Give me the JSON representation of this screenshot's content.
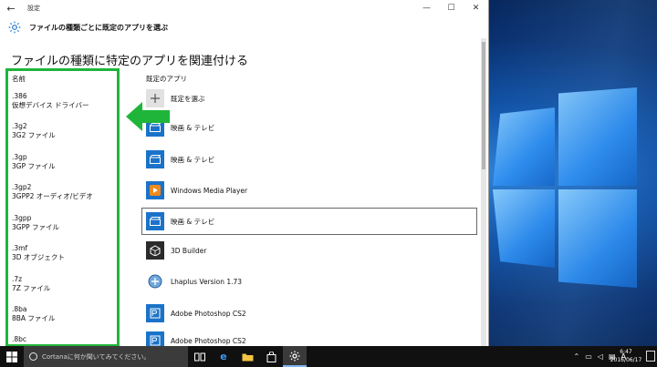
{
  "window": {
    "title": "設定",
    "header": "ファイルの種類ごとに既定のアプリを選ぶ",
    "controls": {
      "minimize": "—",
      "maximize": "☐",
      "close": "✕"
    }
  },
  "page": {
    "title": "ファイルの種類に特定のアプリを関連付ける",
    "col_name": "名前",
    "col_app": "既定のアプリ"
  },
  "file_types": [
    {
      "ext": ".386",
      "desc": "仮想デバイス ドライバー"
    },
    {
      "ext": ".3g2",
      "desc": "3G2 ファイル"
    },
    {
      "ext": ".3gp",
      "desc": "3GP ファイル"
    },
    {
      "ext": ".3gp2",
      "desc": "3GPP2 オーディオ/ビデオ"
    },
    {
      "ext": ".3gpp",
      "desc": "3GPP ファイル"
    },
    {
      "ext": ".3mf",
      "desc": "3D オブジェクト"
    },
    {
      "ext": ".7z",
      "desc": "7Z ファイル"
    },
    {
      "ext": ".8ba",
      "desc": "8BA ファイル"
    },
    {
      "ext": ".8bc",
      "desc": ""
    }
  ],
  "apps": [
    {
      "label": "既定を選ぶ",
      "icon": "plus-icon"
    },
    {
      "label": "映画 & テレビ",
      "icon": "movies-tv-icon"
    },
    {
      "label": "映画 & テレビ",
      "icon": "movies-tv-icon"
    },
    {
      "label": "Windows Media Player",
      "icon": "media-player-icon"
    },
    {
      "label": "映画 & テレビ",
      "icon": "movies-tv-icon"
    },
    {
      "label": "3D Builder",
      "icon": "3d-builder-icon"
    },
    {
      "label": "Lhaplus Version 1.73",
      "icon": "lhaplus-icon"
    },
    {
      "label": "Adobe Photoshop CS2",
      "icon": "photoshop-icon"
    },
    {
      "label": "Adobe Photoshop CS2",
      "icon": "photoshop-icon"
    }
  ],
  "taskbar": {
    "search_placeholder": "Cortanaに何か聞いてみてください。",
    "time": "6:47",
    "date": "2016/06/17"
  },
  "colors": {
    "accent": "#1a73c9",
    "highlight_box": "#1fb53a"
  }
}
